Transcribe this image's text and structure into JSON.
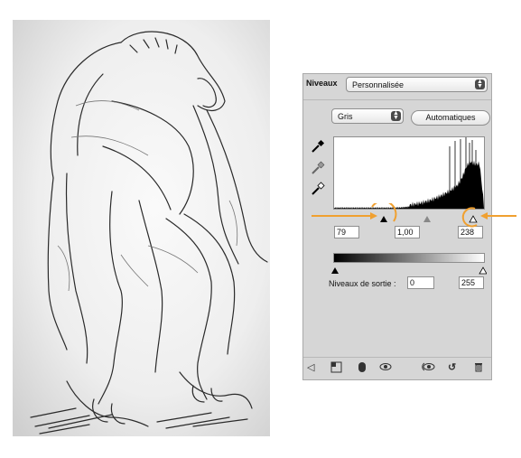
{
  "panel": {
    "title": "Niveaux",
    "preset": {
      "value": "Personnalisée"
    },
    "channel": {
      "value": "Gris"
    },
    "auto_label": "Automatiques",
    "input_levels": {
      "black": "79",
      "gamma": "1,00",
      "white": "238"
    },
    "output_label": "Niveaux de sortie :",
    "output_levels": {
      "black": "0",
      "white": "255"
    },
    "highlight_color": "#f0a030"
  },
  "icons": [
    "black-eyedropper-icon",
    "gray-eyedropper-icon",
    "white-eyedropper-icon",
    "back-arrow-icon",
    "expanded-view-icon",
    "mask-icon",
    "visibility-eye-icon",
    "previous-state-icon",
    "reset-icon",
    "trash-icon"
  ]
}
